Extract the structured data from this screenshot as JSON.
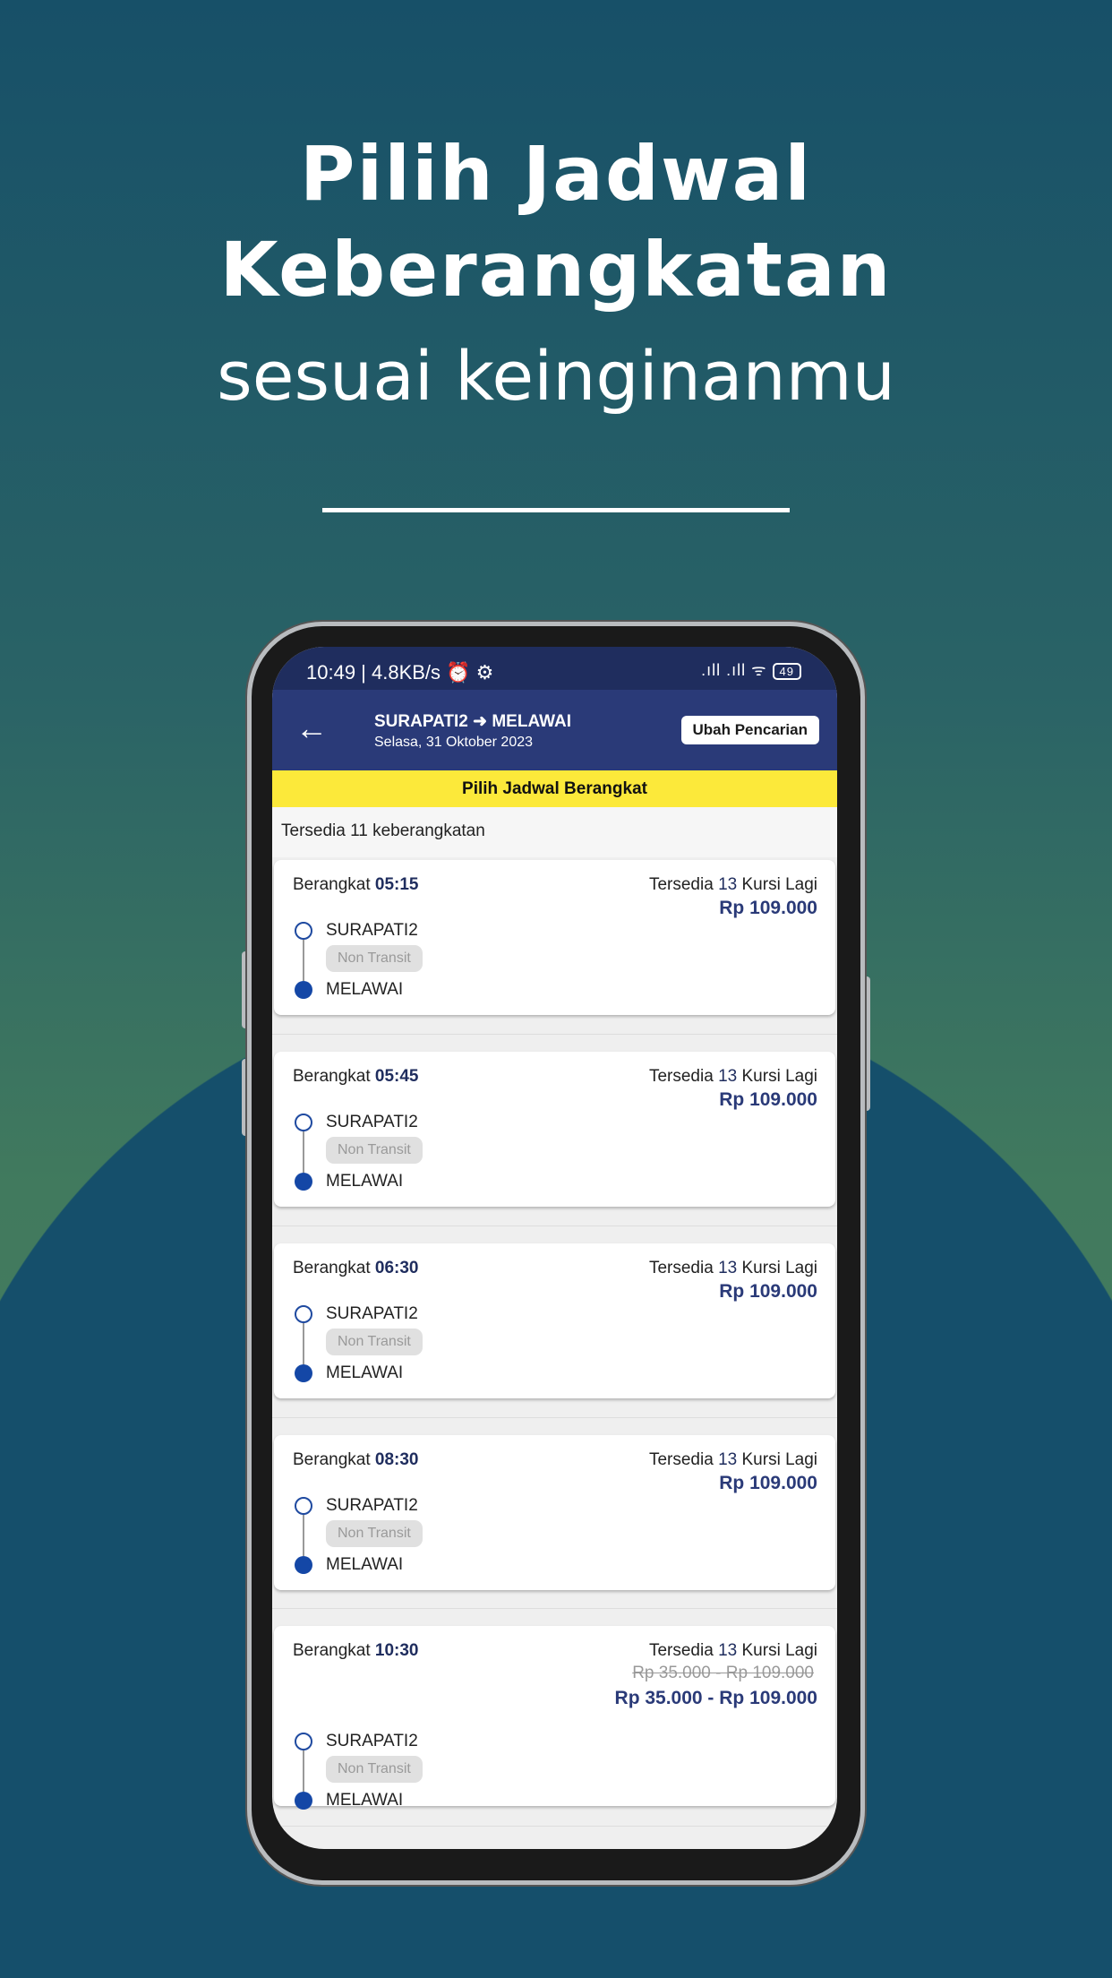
{
  "hero": {
    "line1": "Pilih Jadwal",
    "line2": "Keberangkatan",
    "line3": "sesuai keinginanmu"
  },
  "status_bar": {
    "text": "10:49 | 4.8KB/s ⏰ ⚙",
    "signal": ".ıll .ıll ᯤ",
    "battery": "49"
  },
  "app_bar": {
    "back_icon": "arrow-left-icon",
    "route": "SURAPATI2 ➜ MELAWAI",
    "date": "Selasa, 31 Oktober 2023",
    "change_button": "Ubah Pencarian"
  },
  "banner": "Pilih Jadwal Berangkat",
  "count_text": "Tersedia 11 keberangkatan",
  "colors": {
    "primary": "#2a3a78",
    "banner": "#fce93a",
    "background": "#154f6b"
  },
  "schedules": [
    {
      "label": "Berangkat",
      "time": "05:15",
      "seats_prefix": "Tersedia",
      "seats": "13",
      "seats_suffix": "Kursi Lagi",
      "price": "Rp 109.000",
      "old_price": "",
      "from": "SURAPATI2",
      "transit": "Non Transit",
      "to": "MELAWAI"
    },
    {
      "label": "Berangkat",
      "time": "05:45",
      "seats_prefix": "Tersedia",
      "seats": "13",
      "seats_suffix": "Kursi Lagi",
      "price": "Rp 109.000",
      "old_price": "",
      "from": "SURAPATI2",
      "transit": "Non Transit",
      "to": "MELAWAI"
    },
    {
      "label": "Berangkat",
      "time": "06:30",
      "seats_prefix": "Tersedia",
      "seats": "13",
      "seats_suffix": "Kursi Lagi",
      "price": "Rp 109.000",
      "old_price": "",
      "from": "SURAPATI2",
      "transit": "Non Transit",
      "to": "MELAWAI"
    },
    {
      "label": "Berangkat",
      "time": "08:30",
      "seats_prefix": "Tersedia",
      "seats": "13",
      "seats_suffix": "Kursi Lagi",
      "price": "Rp 109.000",
      "old_price": "",
      "from": "SURAPATI2",
      "transit": "Non Transit",
      "to": "MELAWAI"
    },
    {
      "label": "Berangkat",
      "time": "10:30",
      "seats_prefix": "Tersedia",
      "seats": "13",
      "seats_suffix": "Kursi Lagi",
      "price": "Rp 35.000 - Rp 109.000",
      "old_price": "Rp 35.000 - Rp 109.000",
      "from": "SURAPATI2",
      "transit": "Non Transit",
      "to": "MELAWAI"
    }
  ]
}
